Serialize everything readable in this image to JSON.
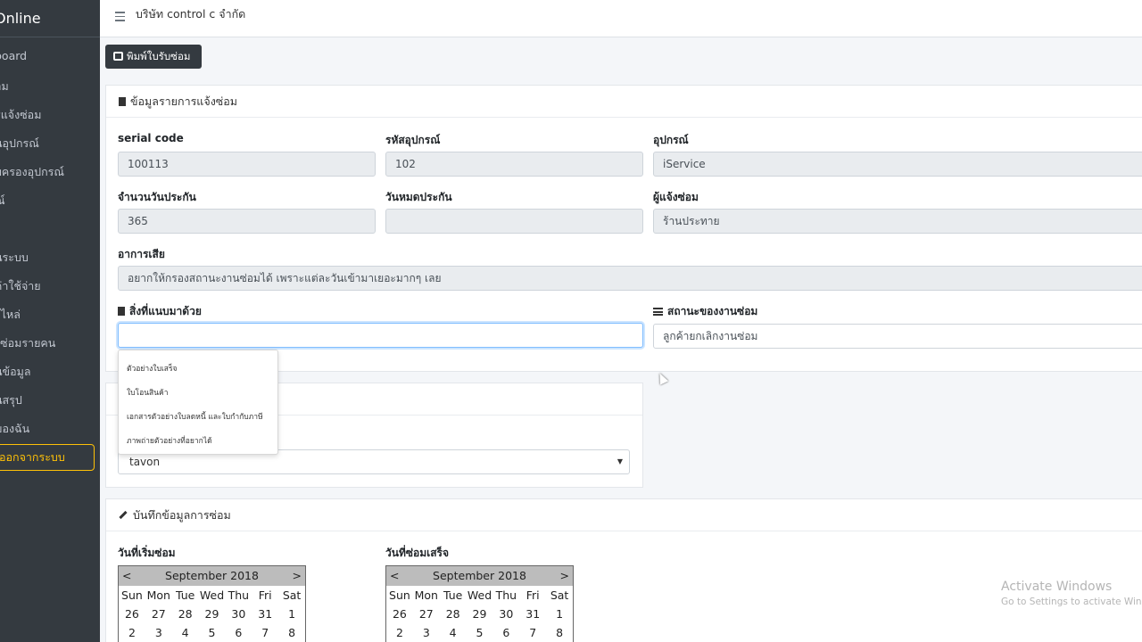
{
  "sidebar": {
    "brand": "Online",
    "items": [
      {
        "label": "board"
      },
      {
        "label": "อม"
      },
      {
        "label": "รแจ้งซ่อม"
      },
      {
        "label": "นอุปกรณ์"
      },
      {
        "label": "บครองอุปกรณ์"
      },
      {
        "label": "ณ์"
      },
      {
        "label": "นระบบ"
      },
      {
        "label": "ค่าใช้จ่าย"
      },
      {
        "label": "ะไหล่"
      },
      {
        "label": "งซ่อมรายคน"
      },
      {
        "label": "นข้อมูล"
      },
      {
        "label": "นสรุป"
      },
      {
        "label": "ของฉัน"
      }
    ],
    "logout": "ออกจากระบบ"
  },
  "topbar": {
    "company": "บริษัท control c จำกัด"
  },
  "print_button": "พิมพ์ใบรับซ่อม",
  "repair_info": {
    "header": "ข้อมูลรายการแจ้งซ่อม",
    "serial_label": "serial code",
    "serial_value": "100113",
    "device_code_label": "รหัสอุปกรณ์",
    "device_code_value": "102",
    "device_label": "อุปกรณ์",
    "device_value": "iService",
    "warranty_days_label": "จำนวนวันประกัน",
    "warranty_days_value": "365",
    "warranty_expire_label": "วันหมดประกัน",
    "warranty_expire_value": "",
    "reporter_label": "ผู้แจ้งซ่อม",
    "reporter_value": "ร้านประทาย",
    "symptom_label": "อาการเสีย",
    "symptom_value": "อยากให้กรองสถานะงานซ่อมได้ เพราะแต่ละวันเข้ามาเยอะมากๆ เลย",
    "attachments_label": "สิ่งที่แนบมาด้วย",
    "attachments_value": "",
    "status_label": "สถานะของงานซ่อม",
    "status_value": "ลูกค้ายกเลิกงานซ่อม"
  },
  "attachment_options": [
    "ตัวอย่างใบเสร็จ",
    "ใบโอนสินค้า",
    "เอกสารตัวอย่างใบลดหนี้ และใบกำกับภาษี",
    "ภาพถ่ายตัวอย่างที่อยากได้"
  ],
  "technician_select": {
    "value": "tavon"
  },
  "repair_record": {
    "header": "บันทึกข้อมูลการซ่อม",
    "start_label": "วันที่เริ่มซ่อม",
    "finish_label": "วันที่ซ่อมเสร็จ"
  },
  "calendar": {
    "prev": "<",
    "next": ">",
    "month": "September 2018",
    "weekdays": [
      "Sun",
      "Mon",
      "Tue",
      "Wed",
      "Thu",
      "Fri",
      "Sat"
    ],
    "week1": [
      "26",
      "27",
      "28",
      "29",
      "30",
      "31",
      "1"
    ],
    "week2": [
      "2",
      "3",
      "4",
      "5",
      "6",
      "7",
      "8"
    ]
  },
  "watermark": {
    "title": "Activate Windows",
    "subtitle": "Go to Settings to activate Windows."
  }
}
